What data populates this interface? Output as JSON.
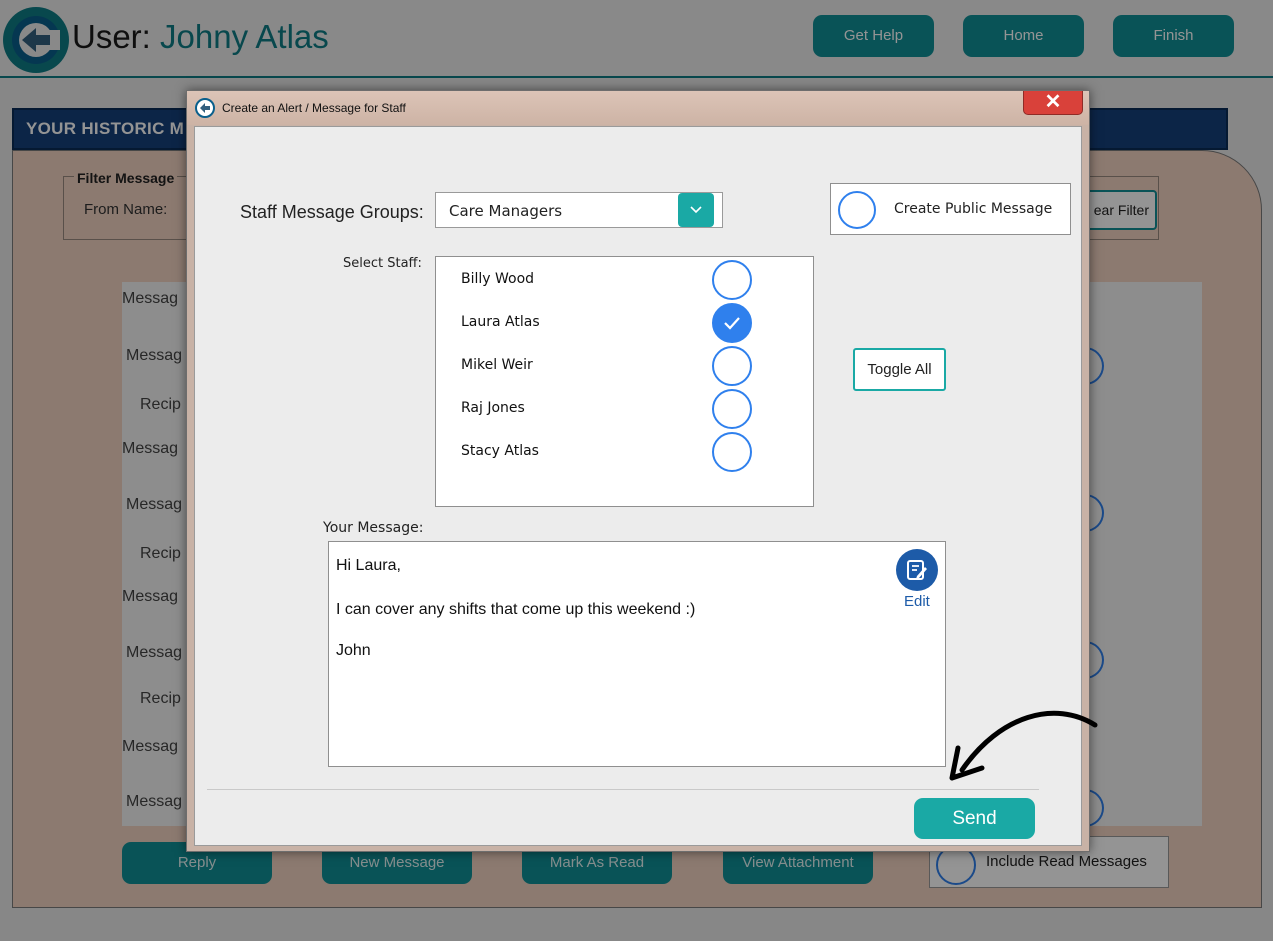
{
  "header": {
    "user_label": "User:",
    "user_name": "Johny Atlas",
    "buttons": {
      "get_help": "Get Help",
      "home": "Home",
      "finish": "Finish"
    }
  },
  "background": {
    "section_title": "YOUR HISTORIC M",
    "filter_title": "Filter Message",
    "from_name_label": "From Name:",
    "clear_filter": "ear Filter",
    "list_rows": [
      "Messag",
      "Messag",
      "Recip",
      "Messag",
      "Messag",
      "Recip",
      "Messag",
      "Messag",
      "Recip",
      "Messag",
      "Messag"
    ],
    "footer_buttons": {
      "reply": "Reply",
      "new_message": "New Message",
      "mark_as_read": "Mark As Read",
      "view_attachment": "View Attachment"
    },
    "include_read": "Include Read Messages"
  },
  "dialog": {
    "title": "Create an Alert / Message for Staff",
    "close_glyph": "✕",
    "groups_label": "Staff Message Groups:",
    "groups_selected": "Care Managers",
    "public_message_label": "Create Public Message",
    "select_staff_label": "Select Staff:",
    "staff": [
      {
        "name": "Billy Wood",
        "checked": false
      },
      {
        "name": "Laura Atlas",
        "checked": true
      },
      {
        "name": "Mikel Weir",
        "checked": false
      },
      {
        "name": "Raj Jones",
        "checked": false
      },
      {
        "name": "Stacy Atlas",
        "checked": false
      }
    ],
    "toggle_all": "Toggle All",
    "your_message_label": "Your Message:",
    "message_lines": [
      "Hi Laura,",
      "I can cover any shifts that come up this weekend :)",
      "John"
    ],
    "edit_label": "Edit",
    "send": "Send"
  },
  "colors": {
    "teal": "#1aa9a5",
    "check_blue": "#2f80ed",
    "edit_blue": "#1d5ba8",
    "close_red": "#d9413a"
  },
  "icons": [
    "app-logo-icon",
    "dialog-app-icon",
    "chevron-down-icon",
    "checkmark-icon",
    "edit-note-icon",
    "curved-arrow-icon"
  ]
}
